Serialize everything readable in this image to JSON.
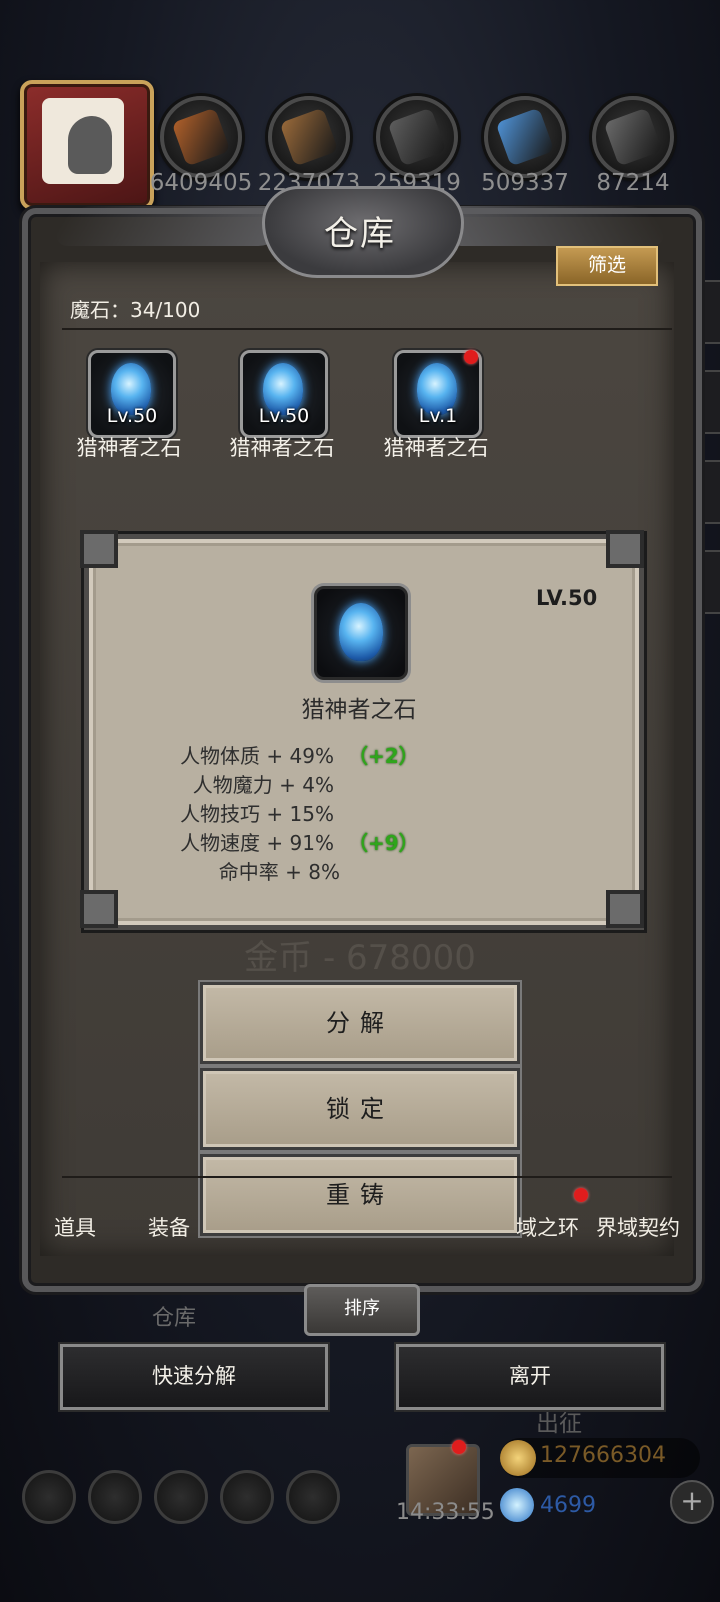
{
  "resources": [
    {
      "icon": "bread-icon",
      "count": "6409405",
      "color": "#b0602a"
    },
    {
      "icon": "wood-planks-icon",
      "count": "2237073",
      "color": "#9a6a3a"
    },
    {
      "icon": "iron-ingot-icon",
      "count": "259319",
      "color": "#5e5e5e"
    },
    {
      "icon": "crystal-icon",
      "count": "509337",
      "color": "#4f92d6"
    },
    {
      "icon": "steel-ingot-icon",
      "count": "87214",
      "color": "#6a6a6a"
    }
  ],
  "panel": {
    "title": "仓库",
    "filter_label": "筛选",
    "stone_count": "魔石：34/100"
  },
  "items": [
    {
      "level": "Lv.50",
      "name": "猎神者之石",
      "has_dot": false
    },
    {
      "level": "Lv.50",
      "name": "猎神者之石",
      "has_dot": false
    },
    {
      "level": "Lv.1",
      "name": "猎神者之石",
      "has_dot": true
    }
  ],
  "detail": {
    "level": "LV.50",
    "name": "猎神者之石",
    "stats": [
      {
        "text": "人物体质 + 49%",
        "bonus": "（+2）"
      },
      {
        "text": "人物魔力 + 4%",
        "bonus": ""
      },
      {
        "text": "人物技巧 + 15%",
        "bonus": ""
      },
      {
        "text": "人物速度 + 91%",
        "bonus": "（+9）"
      },
      {
        "text": "命中率 + 8%",
        "bonus": ""
      }
    ],
    "ghost_price": "金币 - 678000"
  },
  "actions": {
    "decompose": "分解",
    "lock": "锁定",
    "reforge": "重铸"
  },
  "tabs": [
    "道具",
    "装备",
    "域之环",
    "界域契约"
  ],
  "sort_label": "排序",
  "quick_decompose": "快速分解",
  "leave": "离开",
  "hud": {
    "gold": "127666304",
    "gems": "4699",
    "time": "14:33:55",
    "expedition": "出征",
    "warehouse_ghost": "仓库"
  },
  "colors": {
    "bonus_green": "#2fa51b",
    "filter_gold": "#c49a52",
    "red_dot": "#e01d1d"
  }
}
